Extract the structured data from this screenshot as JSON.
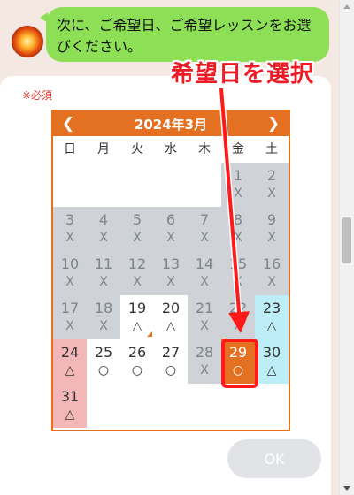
{
  "message": {
    "text": "次に、ご希望日、ご希望レッスンをお選びください。"
  },
  "form": {
    "required_label": "※必須"
  },
  "annotation": {
    "callout": "希望日を選択"
  },
  "calendar": {
    "title": "2024年3月",
    "prev_icon": "chevron-left-icon",
    "next_icon": "chevron-right-icon",
    "weekdays": [
      "日",
      "月",
      "火",
      "水",
      "木",
      "金",
      "土"
    ],
    "weeks": [
      [
        {
          "day": "",
          "mark": ""
        },
        {
          "day": "",
          "mark": ""
        },
        {
          "day": "",
          "mark": ""
        },
        {
          "day": "",
          "mark": ""
        },
        {
          "day": "",
          "mark": ""
        },
        {
          "day": "1",
          "mark": "X"
        },
        {
          "day": "2",
          "mark": "X"
        }
      ],
      [
        {
          "day": "3",
          "mark": "X"
        },
        {
          "day": "4",
          "mark": "X"
        },
        {
          "day": "5",
          "mark": "X"
        },
        {
          "day": "6",
          "mark": "X"
        },
        {
          "day": "7",
          "mark": "X"
        },
        {
          "day": "8",
          "mark": "X"
        },
        {
          "day": "9",
          "mark": "X"
        }
      ],
      [
        {
          "day": "10",
          "mark": "X"
        },
        {
          "day": "11",
          "mark": "X"
        },
        {
          "day": "12",
          "mark": "X"
        },
        {
          "day": "13",
          "mark": "X"
        },
        {
          "day": "14",
          "mark": "X"
        },
        {
          "day": "15",
          "mark": "X"
        },
        {
          "day": "16",
          "mark": "X"
        }
      ],
      [
        {
          "day": "17",
          "mark": "X"
        },
        {
          "day": "18",
          "mark": "X"
        },
        {
          "day": "19",
          "mark": "△"
        },
        {
          "day": "20",
          "mark": "△"
        },
        {
          "day": "21",
          "mark": "X"
        },
        {
          "day": "22",
          "mark": "X"
        },
        {
          "day": "23",
          "mark": "△"
        }
      ],
      [
        {
          "day": "24",
          "mark": "△"
        },
        {
          "day": "25",
          "mark": "○"
        },
        {
          "day": "26",
          "mark": "○"
        },
        {
          "day": "27",
          "mark": "○"
        },
        {
          "day": "28",
          "mark": "X"
        },
        {
          "day": "29",
          "mark": "○"
        },
        {
          "day": "30",
          "mark": "△"
        }
      ],
      [
        {
          "day": "31",
          "mark": "△"
        },
        {
          "day": "",
          "mark": ""
        },
        {
          "day": "",
          "mark": ""
        },
        {
          "day": "",
          "mark": ""
        },
        {
          "day": "",
          "mark": ""
        },
        {
          "day": "",
          "mark": ""
        },
        {
          "day": "",
          "mark": ""
        }
      ]
    ],
    "selected_day": "29"
  },
  "actions": {
    "ok_label": "OK"
  },
  "colors": {
    "accent": "#e37121",
    "bubble": "#8de055",
    "unavailable": "#cfd3d8",
    "saturday": "#bdeef7",
    "sunday": "#f3b7b7",
    "callout": "#ec1c24"
  }
}
